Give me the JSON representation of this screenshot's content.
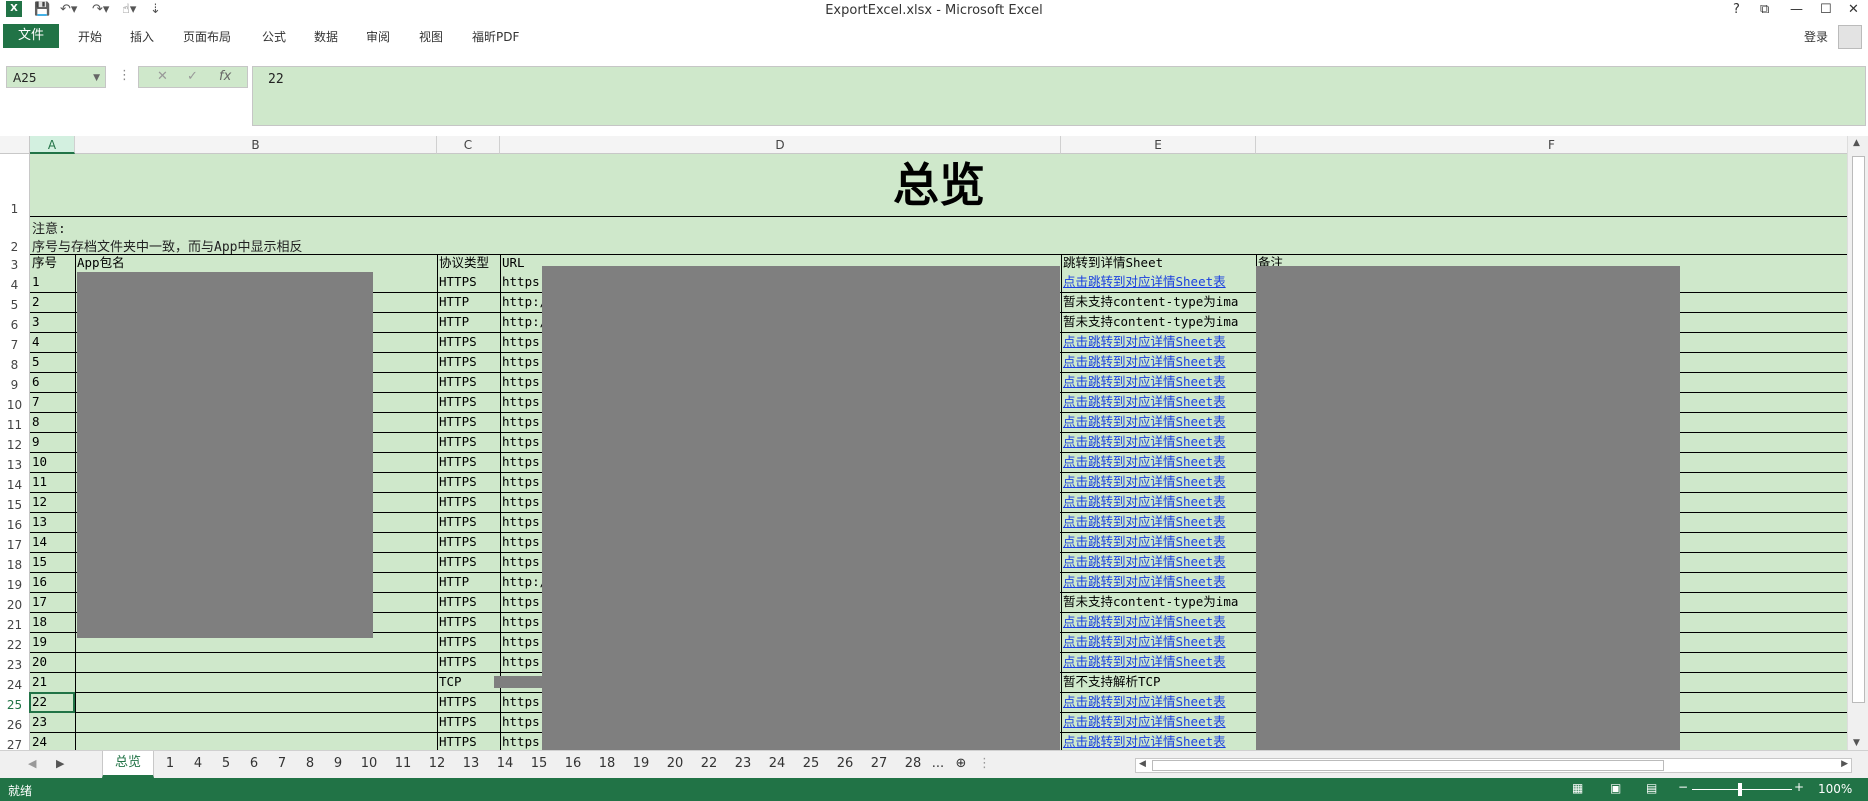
{
  "window": {
    "title": "ExportExcel.xlsx - Microsoft Excel",
    "buttons": [
      "?",
      "⧉",
      "—",
      "☐",
      "✕"
    ]
  },
  "ribbon": {
    "file_tab": "文件",
    "tabs": [
      "开始",
      "插入",
      "页面布局",
      "公式",
      "数据",
      "审阅",
      "视图",
      "福昕PDF"
    ],
    "login": "登录"
  },
  "formula_bar": {
    "name_box": "A25",
    "fx": "fx",
    "value": "22"
  },
  "columns": [
    "A",
    "B",
    "C",
    "D",
    "E",
    "F"
  ],
  "selected_column": "A",
  "sheet": {
    "title": "总览",
    "note_line1": "注意:",
    "note_line2": "序号与存档文件夹中一致，而与App中显示相反",
    "headers": {
      "seq": "序号",
      "app": "App包名",
      "protocol": "协议类型",
      "url": "URL",
      "jump": "跳转到详情Sheet",
      "remark": "备注"
    },
    "rows": [
      {
        "row": "4",
        "seq": "1",
        "protocol": "HTTPS",
        "url": "https:",
        "jump": "点击跳转到对应详情Sheet表",
        "link": true
      },
      {
        "row": "5",
        "seq": "2",
        "protocol": "HTTP",
        "url": "http:/",
        "jump": "暂未支持content-type为ima",
        "link": false
      },
      {
        "row": "6",
        "seq": "3",
        "protocol": "HTTP",
        "url": "http:/",
        "jump": "暂未支持content-type为ima",
        "link": false
      },
      {
        "row": "7",
        "seq": "4",
        "protocol": "HTTPS",
        "url": "https:",
        "jump": "点击跳转到对应详情Sheet表",
        "link": true
      },
      {
        "row": "8",
        "seq": "5",
        "protocol": "HTTPS",
        "url": "https:",
        "jump": "点击跳转到对应详情Sheet表",
        "link": true
      },
      {
        "row": "9",
        "seq": "6",
        "protocol": "HTTPS",
        "url": "https:",
        "jump": "点击跳转到对应详情Sheet表",
        "link": true
      },
      {
        "row": "10",
        "seq": "7",
        "protocol": "HTTPS",
        "url": "https:",
        "jump": "点击跳转到对应详情Sheet表",
        "link": true
      },
      {
        "row": "11",
        "seq": "8",
        "protocol": "HTTPS",
        "url": "https:",
        "jump": "点击跳转到对应详情Sheet表",
        "link": true
      },
      {
        "row": "12",
        "seq": "9",
        "protocol": "HTTPS",
        "url": "https:",
        "jump": "点击跳转到对应详情Sheet表",
        "link": true
      },
      {
        "row": "13",
        "seq": "10",
        "protocol": "HTTPS",
        "url": "https:",
        "jump": "点击跳转到对应详情Sheet表",
        "link": true
      },
      {
        "row": "14",
        "seq": "11",
        "protocol": "HTTPS",
        "url": "https:",
        "jump": "点击跳转到对应详情Sheet表",
        "link": true
      },
      {
        "row": "15",
        "seq": "12",
        "protocol": "HTTPS",
        "url": "https:",
        "jump": "点击跳转到对应详情Sheet表",
        "link": true
      },
      {
        "row": "16",
        "seq": "13",
        "protocol": "HTTPS",
        "url": "https:",
        "jump": "点击跳转到对应详情Sheet表",
        "link": true
      },
      {
        "row": "17",
        "seq": "14",
        "protocol": "HTTPS",
        "url": "https:",
        "jump": "点击跳转到对应详情Sheet表",
        "link": true
      },
      {
        "row": "18",
        "seq": "15",
        "protocol": "HTTPS",
        "url": "https:",
        "jump": "点击跳转到对应详情Sheet表",
        "link": true
      },
      {
        "row": "19",
        "seq": "16",
        "protocol": "HTTP",
        "url": "http:/",
        "jump": "点击跳转到对应详情Sheet表",
        "link": true
      },
      {
        "row": "20",
        "seq": "17",
        "protocol": "HTTPS",
        "url": "https:",
        "jump": "暂未支持content-type为ima",
        "link": false
      },
      {
        "row": "21",
        "seq": "18",
        "protocol": "HTTPS",
        "url": "https:",
        "jump": "点击跳转到对应详情Sheet表",
        "link": true
      },
      {
        "row": "22",
        "seq": "19",
        "protocol": "HTTPS",
        "url": "https:",
        "jump": "点击跳转到对应详情Sheet表",
        "link": true
      },
      {
        "row": "23",
        "seq": "20",
        "protocol": "HTTPS",
        "url": "https:",
        "jump": "点击跳转到对应详情Sheet表",
        "link": true
      },
      {
        "row": "24",
        "seq": "21",
        "protocol": "TCP",
        "url": "",
        "jump": "暂不支持解析TCP",
        "link": false
      },
      {
        "row": "25",
        "seq": "22",
        "protocol": "HTTPS",
        "url": "https:",
        "jump": "点击跳转到对应详情Sheet表",
        "link": true
      },
      {
        "row": "26",
        "seq": "23",
        "protocol": "HTTPS",
        "url": "https:",
        "jump": "点击跳转到对应详情Sheet表",
        "link": true
      },
      {
        "row": "27",
        "seq": "24",
        "protocol": "HTTPS",
        "url": "https:",
        "jump": "点击跳转到对应详情Sheet表",
        "link": true
      }
    ]
  },
  "sheet_tabs": {
    "active": "总览",
    "tabs": [
      "1",
      "4",
      "5",
      "6",
      "7",
      "8",
      "9",
      "10",
      "11",
      "12",
      "13",
      "14",
      "15",
      "16",
      "18",
      "19",
      "20",
      "22",
      "23",
      "24",
      "25",
      "26",
      "27",
      "28"
    ],
    "more": "..."
  },
  "status": {
    "ready": "就绪",
    "zoom": "100%"
  },
  "colors": {
    "excel_green": "#217346",
    "cell_fill": "#cfe8cb",
    "link": "#1a3fe0",
    "redaction": "#7f7f7f"
  }
}
